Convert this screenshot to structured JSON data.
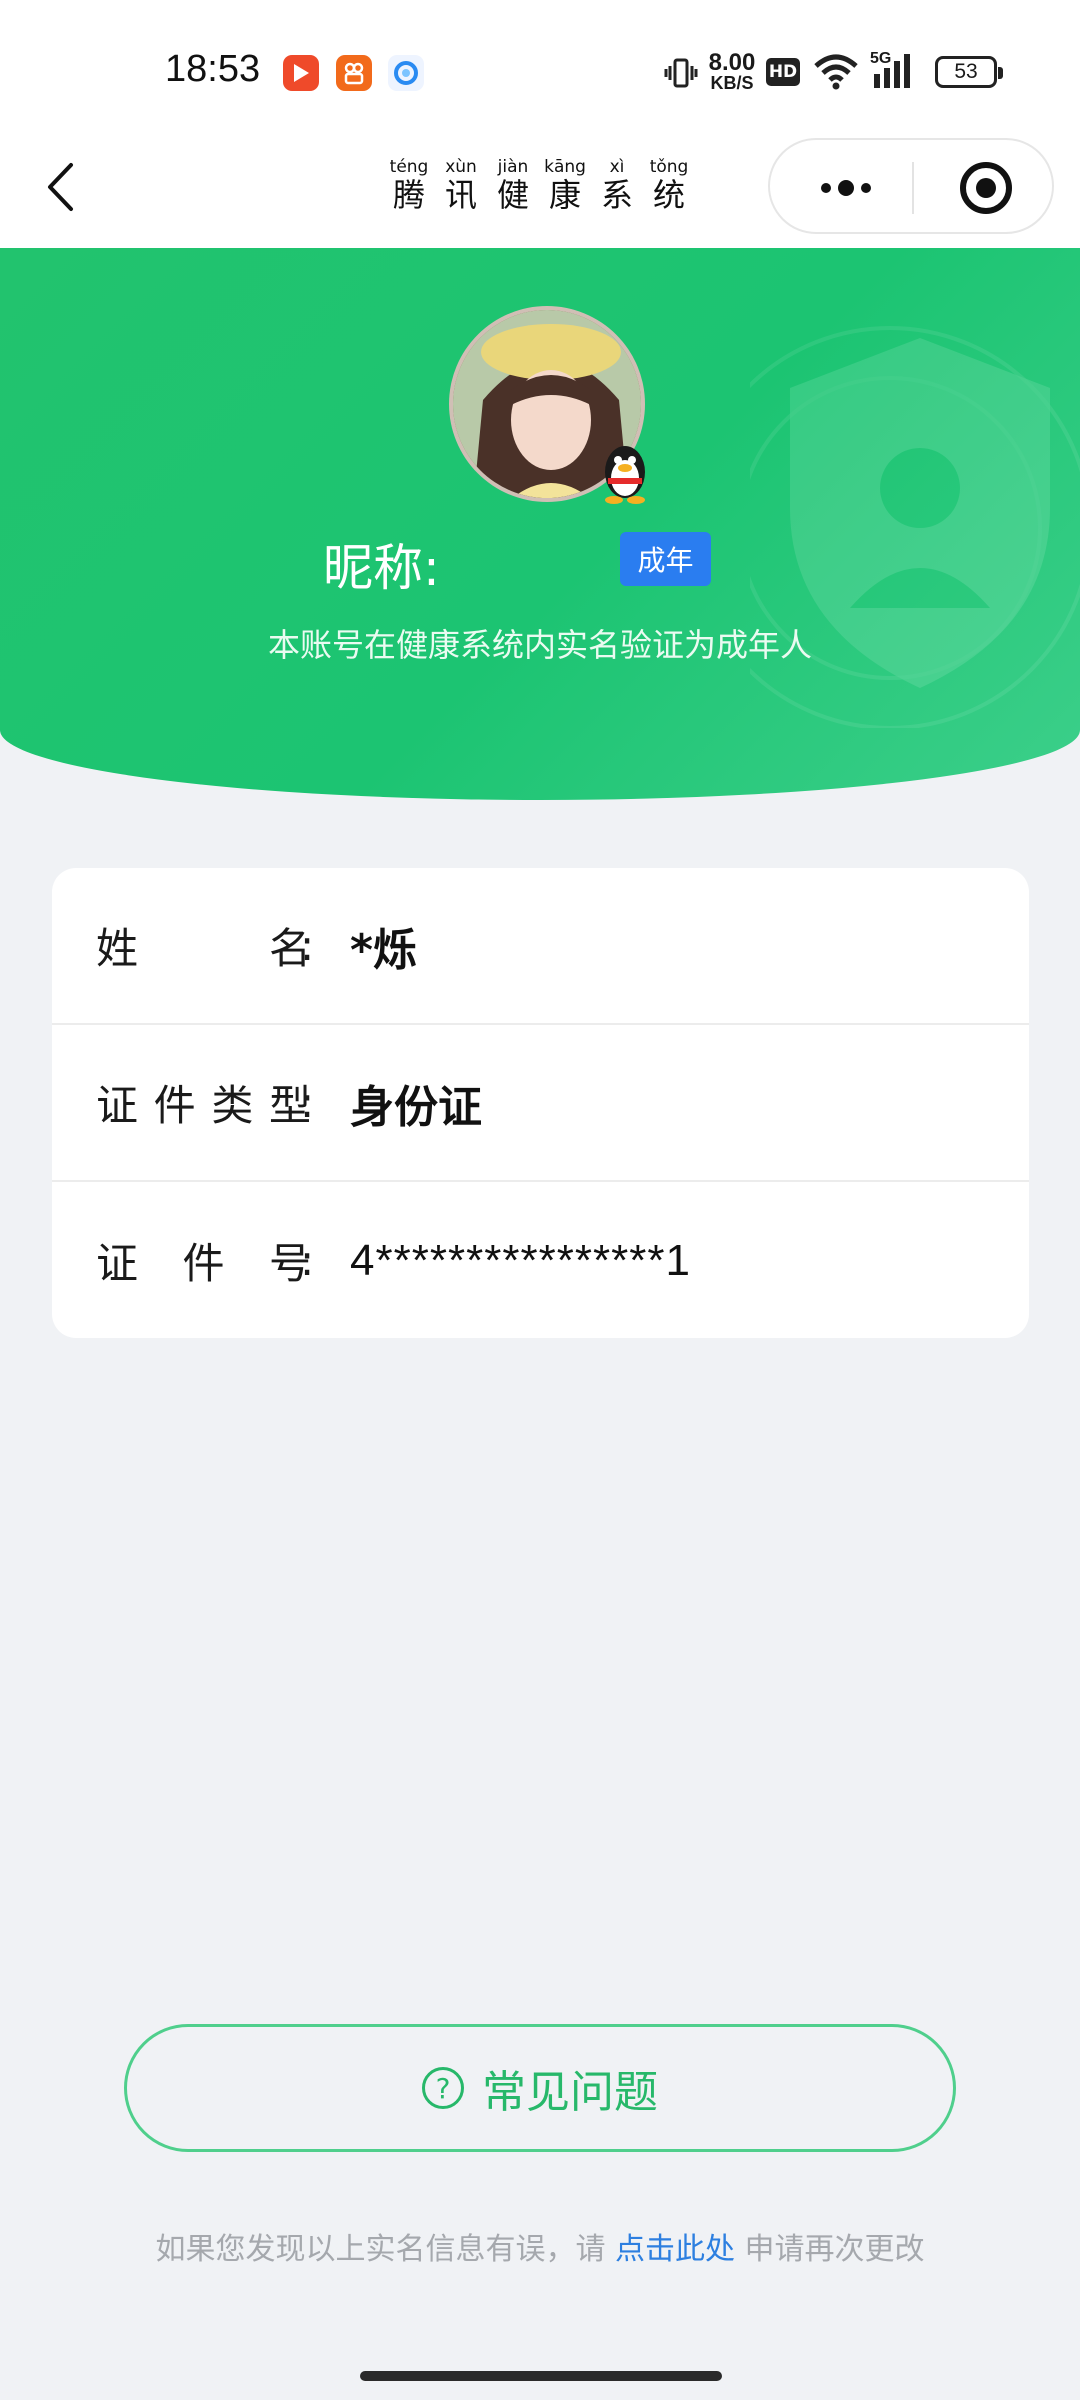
{
  "status_bar": {
    "time": "18:53",
    "network_speed_value": "8.00",
    "network_speed_unit": "KB/S",
    "hd_label": "HD",
    "signal_label": "5G",
    "battery": "53",
    "icons": [
      "video-app-icon",
      "kuaishou-app-icon",
      "browser-app-icon",
      "vibrate-icon",
      "wifi-icon",
      "signal-icon",
      "battery-icon"
    ]
  },
  "nav": {
    "title_chars": [
      {
        "pinyin": "téng",
        "hanzi": "腾"
      },
      {
        "pinyin": "xùn",
        "hanzi": "讯"
      },
      {
        "pinyin": "jiàn",
        "hanzi": "健"
      },
      {
        "pinyin": "kāng",
        "hanzi": "康"
      },
      {
        "pinyin": "xì",
        "hanzi": "系"
      },
      {
        "pinyin": "tǒng",
        "hanzi": "统"
      }
    ]
  },
  "profile": {
    "nickname_label": "昵称:",
    "age_tag": "成年",
    "description": "本账号在健康系统内实名验证为成年人"
  },
  "info": {
    "name_label_chars": [
      "姓",
      "名"
    ],
    "name_value": "*烁",
    "id_type_label_chars": [
      "证",
      "件",
      "类",
      "型"
    ],
    "id_type_value": "身份证",
    "id_number_label_chars": [
      "证",
      "件",
      "号"
    ],
    "id_number_value": "4****************1",
    "colon": ":"
  },
  "faq_button": {
    "label": "常见问题",
    "icon_glyph": "?"
  },
  "footer": {
    "prefix": "如果您发现以上实名信息有误，请 ",
    "link": "点击此处",
    "suffix": " 申请再次更改"
  },
  "colors": {
    "brand_green": "#22c36e",
    "adult_tag_blue": "#2a7df0",
    "link_blue": "#2d7fe0"
  }
}
